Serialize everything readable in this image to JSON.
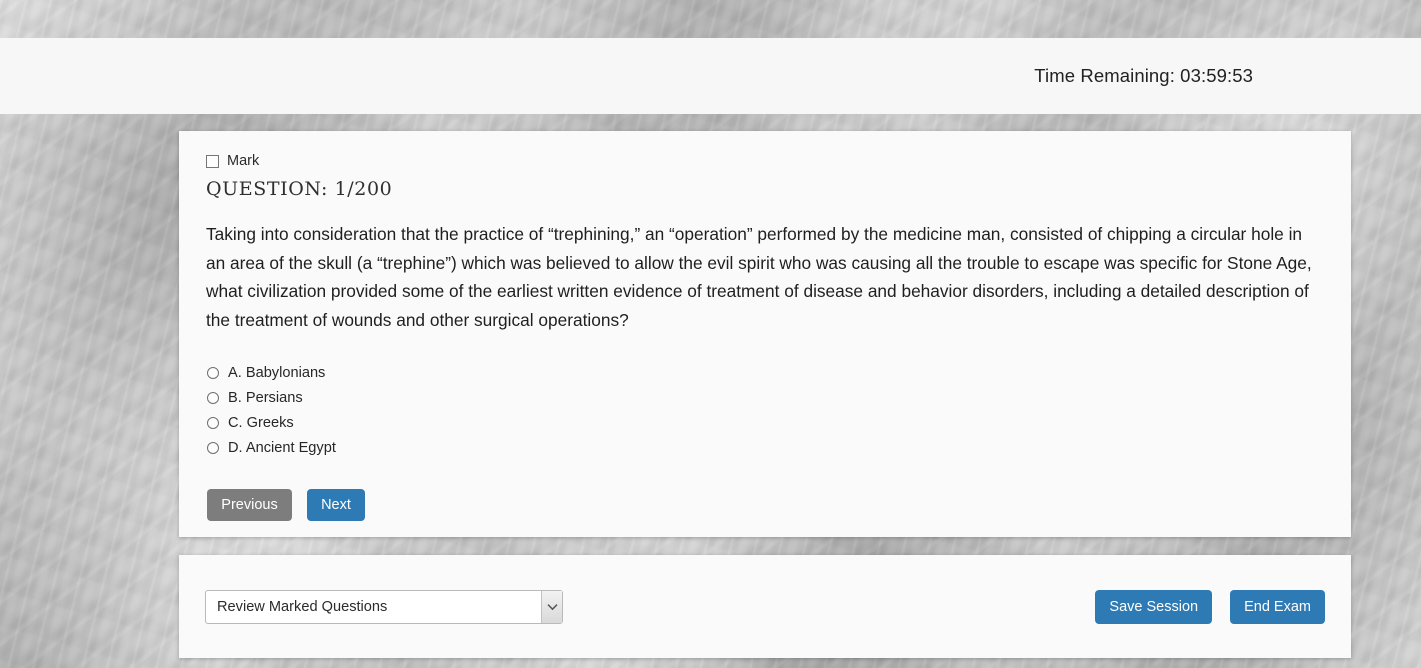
{
  "header": {
    "timer_label": "Time Remaining: 03:59:53"
  },
  "question_card": {
    "mark_label": "Mark",
    "question_number": "QUESTION: 1/200",
    "question_text": "Taking into consideration that the practice of “trephining,” an “operation” performed by the medicine man, consisted of chipping a circular hole in an area of the skull (a “trephine”) which was believed to allow the evil spirit who was causing all the trouble to escape was specific for Stone Age, what civilization provided some of the earliest written evidence of treatment of disease and behavior disorders, including a detailed description of the treatment of wounds and other surgical operations?",
    "options": [
      {
        "label": "A. Babylonians",
        "selected": false
      },
      {
        "label": "B. Persians",
        "selected": false
      },
      {
        "label": "C. Greeks",
        "selected": false
      },
      {
        "label": "D. Ancient Egypt",
        "selected": false
      }
    ],
    "previous_label": "Previous",
    "next_label": "Next"
  },
  "footer": {
    "review_selected": "Review Marked Questions",
    "review_options": [
      "Review Marked Questions"
    ],
    "save_session_label": "Save Session",
    "end_exam_label": "End Exam"
  },
  "colors": {
    "primary_button": "#2e7ab5",
    "secondary_button": "#7d7d7d",
    "card_background": "#fafafa",
    "header_background": "#f7f7f7"
  }
}
